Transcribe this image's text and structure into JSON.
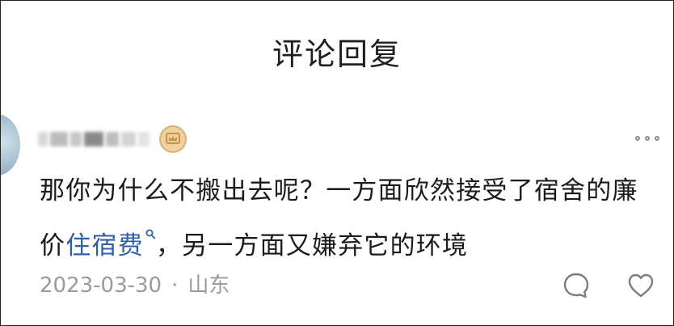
{
  "header": {
    "title": "评论回复"
  },
  "comment": {
    "text_before_link": "那你为什么不搬出去呢？一方面欣然接受了宿舍的廉价",
    "link_text": "住宿费",
    "text_after_link": "，另一方面又嫌弃它的环境",
    "date": "2023-03-30",
    "separator": "·",
    "location": "山东"
  },
  "icons": {
    "avatar": "avatar-image",
    "badge": "crown-badge-icon",
    "more": "more-dots-icon",
    "link_search": "search-icon",
    "reply": "comment-bubble-icon",
    "like": "heart-icon"
  },
  "colors": {
    "link": "#2f5fa7",
    "meta_text": "#9a9a9a",
    "badge_fill": "#efd2a2",
    "badge_border": "#d9b071"
  }
}
